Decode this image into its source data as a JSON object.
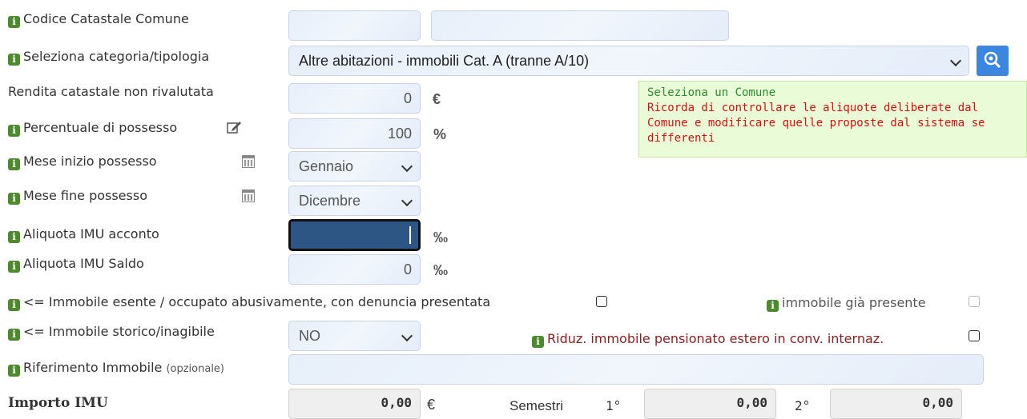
{
  "fields": {
    "codice_catastale": {
      "label": "Codice Catastale Comune"
    },
    "categoria": {
      "label": "Seleziona categoria/tipologia",
      "value": "Altre abitazioni - immobili Cat. A (tranne A/10)"
    },
    "rendita": {
      "label": "Rendita catastale non rivalutata",
      "value": "0",
      "unit": "€"
    },
    "percentuale": {
      "label": "Percentuale di possesso",
      "value": "100",
      "unit": "%"
    },
    "mese_inizio": {
      "label": "Mese inizio possesso",
      "value": "Gennaio"
    },
    "mese_fine": {
      "label": "Mese fine possesso",
      "value": "Dicembre"
    },
    "aliquota_acconto": {
      "label": "Aliquota IMU acconto",
      "unit": "‰"
    },
    "aliquota_saldo": {
      "label": "Aliquota IMU Saldo",
      "value": "0",
      "unit": "‰"
    },
    "esente": {
      "label": "<= Immobile esente / occupato abusivamente, con denuncia presentata"
    },
    "gia_presente": {
      "label": "immobile già presente"
    },
    "storico": {
      "label": "<= Immobile storico/inagibile",
      "value": "NO"
    },
    "pensionato": {
      "label": "Riduz. immobile pensionato estero in conv. internaz."
    },
    "riferimento": {
      "label": "Riferimento Immobile",
      "hint": "(opzionale)"
    },
    "importo": {
      "label": "Importo IMU",
      "value": "0,00",
      "unit": "€"
    }
  },
  "semestri": {
    "label": "Semestri",
    "first_label": "1°",
    "first_value": "0,00",
    "second_label": "2°",
    "second_value": "0,00"
  },
  "tooltip": {
    "line1": "Seleziona un Comune",
    "line2": "Ricorda di controllare le aliquote deliberate dal",
    "line3": "Comune e modificare quelle proposte dal sistema se",
    "line4": "differenti"
  },
  "icons": {
    "info": "info-icon",
    "search": "search-icon",
    "edit": "edit-icon",
    "calendar": "calendar-icon",
    "chevron": "chevron-down-icon"
  },
  "colors": {
    "info_green": "#4d8a2e",
    "search_blue": "#3a86e0",
    "tooltip_bg": "#eafbd8",
    "warn_red": "#d41111",
    "ok_green": "#2a8c2a",
    "pensionato_red": "#8b2020"
  }
}
